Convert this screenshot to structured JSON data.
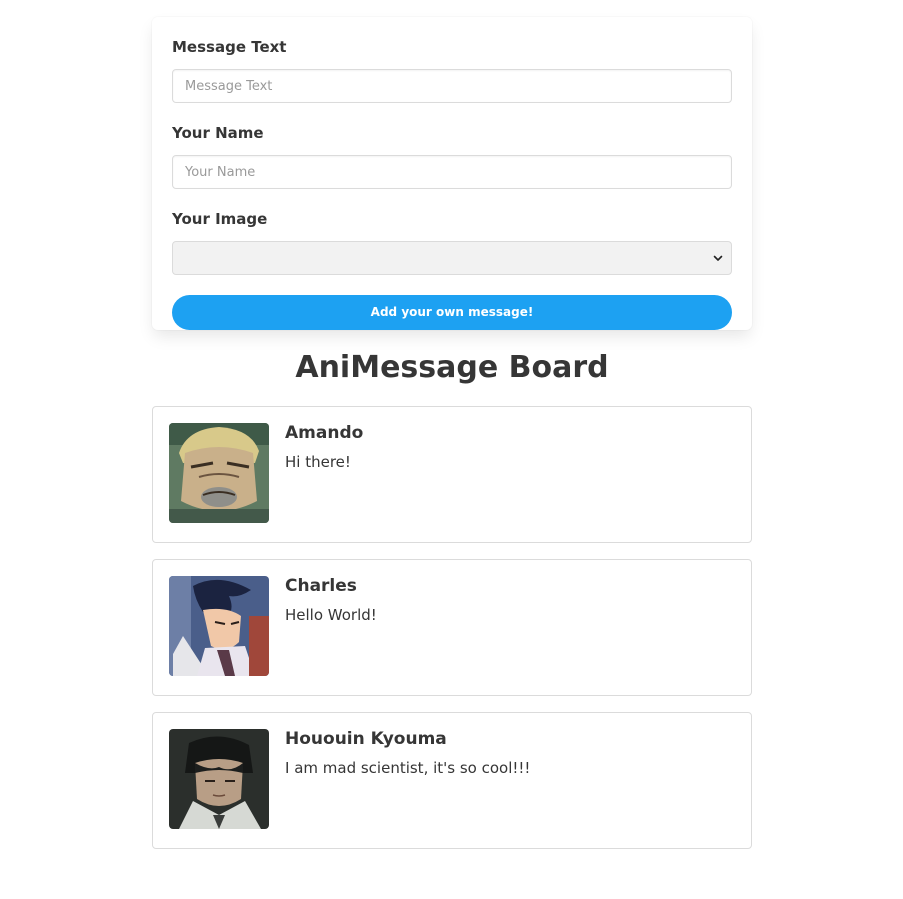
{
  "form": {
    "message_label": "Message Text",
    "message_placeholder": "Message Text",
    "message_value": "",
    "name_label": "Your Name",
    "name_placeholder": "Your Name",
    "name_value": "",
    "image_label": "Your Image",
    "image_selected": "",
    "submit_label": "Add your own message!"
  },
  "board": {
    "title": "AniMessage Board"
  },
  "messages": [
    {
      "name": "Amando",
      "text": "Hi there!",
      "avatar_icon": "anime-avatar-amando"
    },
    {
      "name": "Charles",
      "text": "Hello World!",
      "avatar_icon": "anime-avatar-charles"
    },
    {
      "name": "Hououin Kyouma",
      "text": "I am mad scientist, it's so cool!!!",
      "avatar_icon": "anime-avatar-hououin"
    }
  ],
  "colors": {
    "accent": "#1da1f2",
    "text": "#363636",
    "border": "#dbdbdb"
  }
}
